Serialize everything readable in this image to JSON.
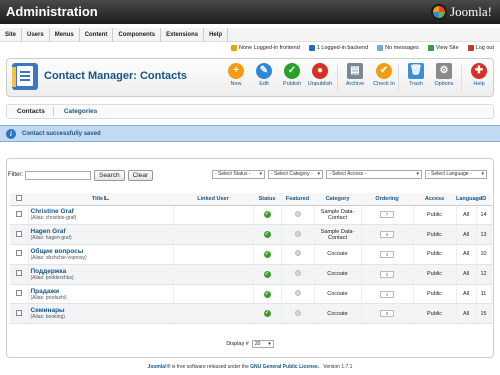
{
  "header": {
    "title": "Administration",
    "logo_text": "Joomla!"
  },
  "menu": [
    "Site",
    "Users",
    "Menus",
    "Content",
    "Components",
    "Extensions",
    "Help"
  ],
  "status": [
    {
      "label": "None Logged-in frontend",
      "color": "#e6a400"
    },
    {
      "label": "1 Logged-in backend",
      "color": "#1f6ec2"
    },
    {
      "label": "No messages",
      "color": "#7aa8d8"
    },
    {
      "label": "View Site",
      "color": "#3a9b3a"
    },
    {
      "label": "Log out",
      "color": "#c0392b"
    }
  ],
  "toolbar": {
    "title": "Contact Manager: Contacts",
    "buttons": [
      {
        "label": "New",
        "color": "#f39c12",
        "glyph": "+"
      },
      {
        "label": "Edit",
        "color": "#2e86d6",
        "glyph": "✎"
      },
      {
        "label": "Publish",
        "color": "#27a027",
        "glyph": "✓"
      },
      {
        "label": "Unpublish",
        "color": "#d93025",
        "glyph": "●"
      },
      {
        "label": "Archive",
        "color": "#7a8896",
        "glyph": "▤"
      },
      {
        "label": "Check In",
        "color": "#f39c12",
        "glyph": "✔"
      },
      {
        "label": "Trash",
        "color": "#3b8fd6",
        "glyph": "🗑"
      },
      {
        "label": "Options",
        "color": "#8a8a8a",
        "glyph": "⚙"
      },
      {
        "label": "Help",
        "color": "#d93025",
        "glyph": "✚"
      }
    ]
  },
  "tabs": [
    "Contacts",
    "Categories"
  ],
  "message": "Contact successfully saved",
  "filter": {
    "label": "Filter:",
    "search_label": "Search",
    "clear_label": "Clear",
    "selects": [
      "- Select Status -",
      "- Select Category -",
      "- Select Access -",
      "- Select Language -"
    ]
  },
  "table": {
    "headers": [
      "Title",
      "Linked User",
      "Status",
      "Featured",
      "Category",
      "Ordering",
      "Access",
      "Language",
      "ID"
    ],
    "rows": [
      {
        "title": "Christine Graf",
        "alias": "(Alias: christine-graf)",
        "category": "Sample Data-Contact",
        "ordering": "7",
        "access": "Public",
        "language": "All",
        "id": "14"
      },
      {
        "title": "Hagen Graf",
        "alias": "(Alias: hagen-graf)",
        "category": "Sample Data-Contact",
        "ordering": "6",
        "access": "Public",
        "language": "All",
        "id": "13"
      },
      {
        "title": "Общие вопросы",
        "alias": "(Alias: obshchie-voprosy)",
        "category": "Cocoate",
        "ordering": "3",
        "access": "Public",
        "language": "All",
        "id": "10"
      },
      {
        "title": "Поддержка",
        "alias": "(Alias: podderzhka)",
        "category": "Cocoate",
        "ordering": "2",
        "access": "Public",
        "language": "All",
        "id": "12"
      },
      {
        "title": "Прадажи",
        "alias": "(Alias: prodazhi)",
        "category": "Cocoate",
        "ordering": "4",
        "access": "Public",
        "language": "All",
        "id": "11"
      },
      {
        "title": "Семинары",
        "alias": "(Alias: booking)",
        "category": "Cocoate",
        "ordering": "8",
        "access": "Public",
        "language": "All",
        "id": "15"
      }
    ]
  },
  "pager": {
    "label": "Display #",
    "value": "20"
  },
  "footer": {
    "brand": "Joomla!®",
    "text": " is free software released under the ",
    "license": "GNU General Public License.",
    "version": "Version 1.7.1"
  }
}
